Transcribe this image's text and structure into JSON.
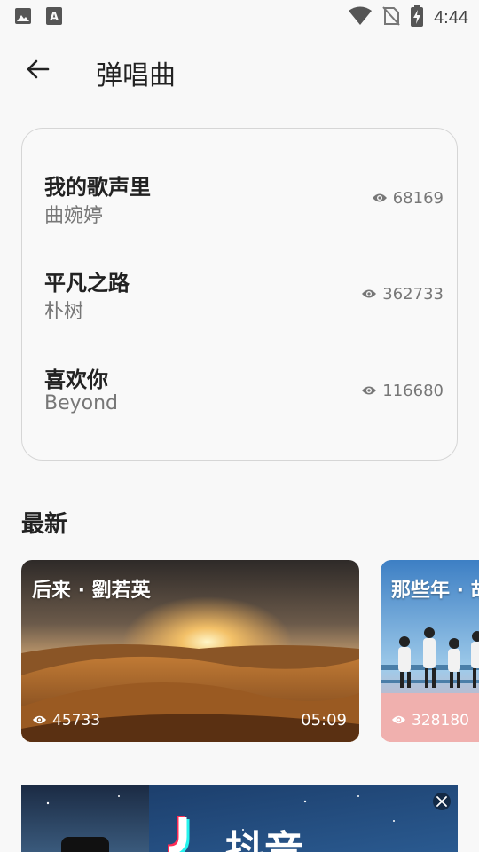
{
  "status_bar": {
    "time": "4:44",
    "icons": [
      "image-icon",
      "font-icon",
      "wifi-icon",
      "no-sim-icon",
      "battery-charging-icon"
    ]
  },
  "app_bar": {
    "back_icon": "arrow-left-icon",
    "title": "弹唱曲"
  },
  "songs": [
    {
      "title": "我的歌声里",
      "artist": "曲婉婷",
      "views": "68169"
    },
    {
      "title": "平凡之路",
      "artist": "朴树",
      "views": "362733"
    },
    {
      "title": "喜欢你",
      "artist": "Beyond",
      "views": "116680"
    }
  ],
  "latest": {
    "title": "最新",
    "videos": [
      {
        "title": "后来 · 劉若英",
        "views": "45733",
        "duration": "05:09"
      },
      {
        "title": "那些年 · 胡",
        "views": "328180",
        "duration": ""
      }
    ]
  },
  "ad": {
    "close_icon": "close-icon",
    "text": "抖音"
  },
  "colors": {
    "background": "#f8f8f8",
    "card_border": "#d6d6d6",
    "primary_text": "#222222",
    "secondary_text": "#777777"
  }
}
